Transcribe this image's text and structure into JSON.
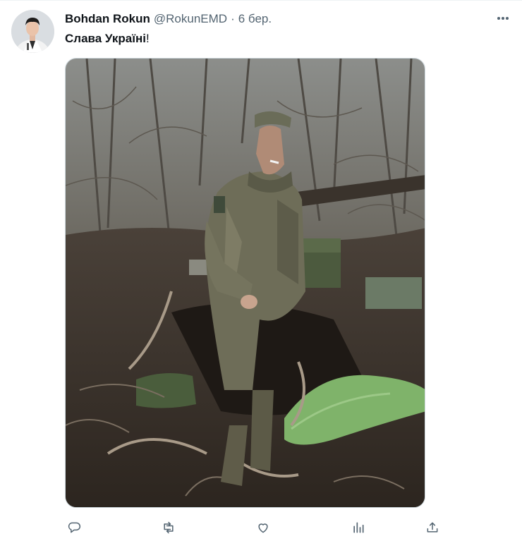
{
  "post": {
    "author_name": "Bohdan Rokun",
    "author_handle": "@RokunEMD",
    "separator": "·",
    "date": "6 бер.",
    "text_main": "Слава Україні",
    "text_punct": "!"
  },
  "actions": {
    "icons": [
      "reply-icon",
      "repost-icon",
      "like-icon",
      "views-icon",
      "share-icon"
    ]
  },
  "colors": {
    "text_primary": "#0f1419",
    "text_secondary": "#536471",
    "border": "#cfd9de"
  }
}
